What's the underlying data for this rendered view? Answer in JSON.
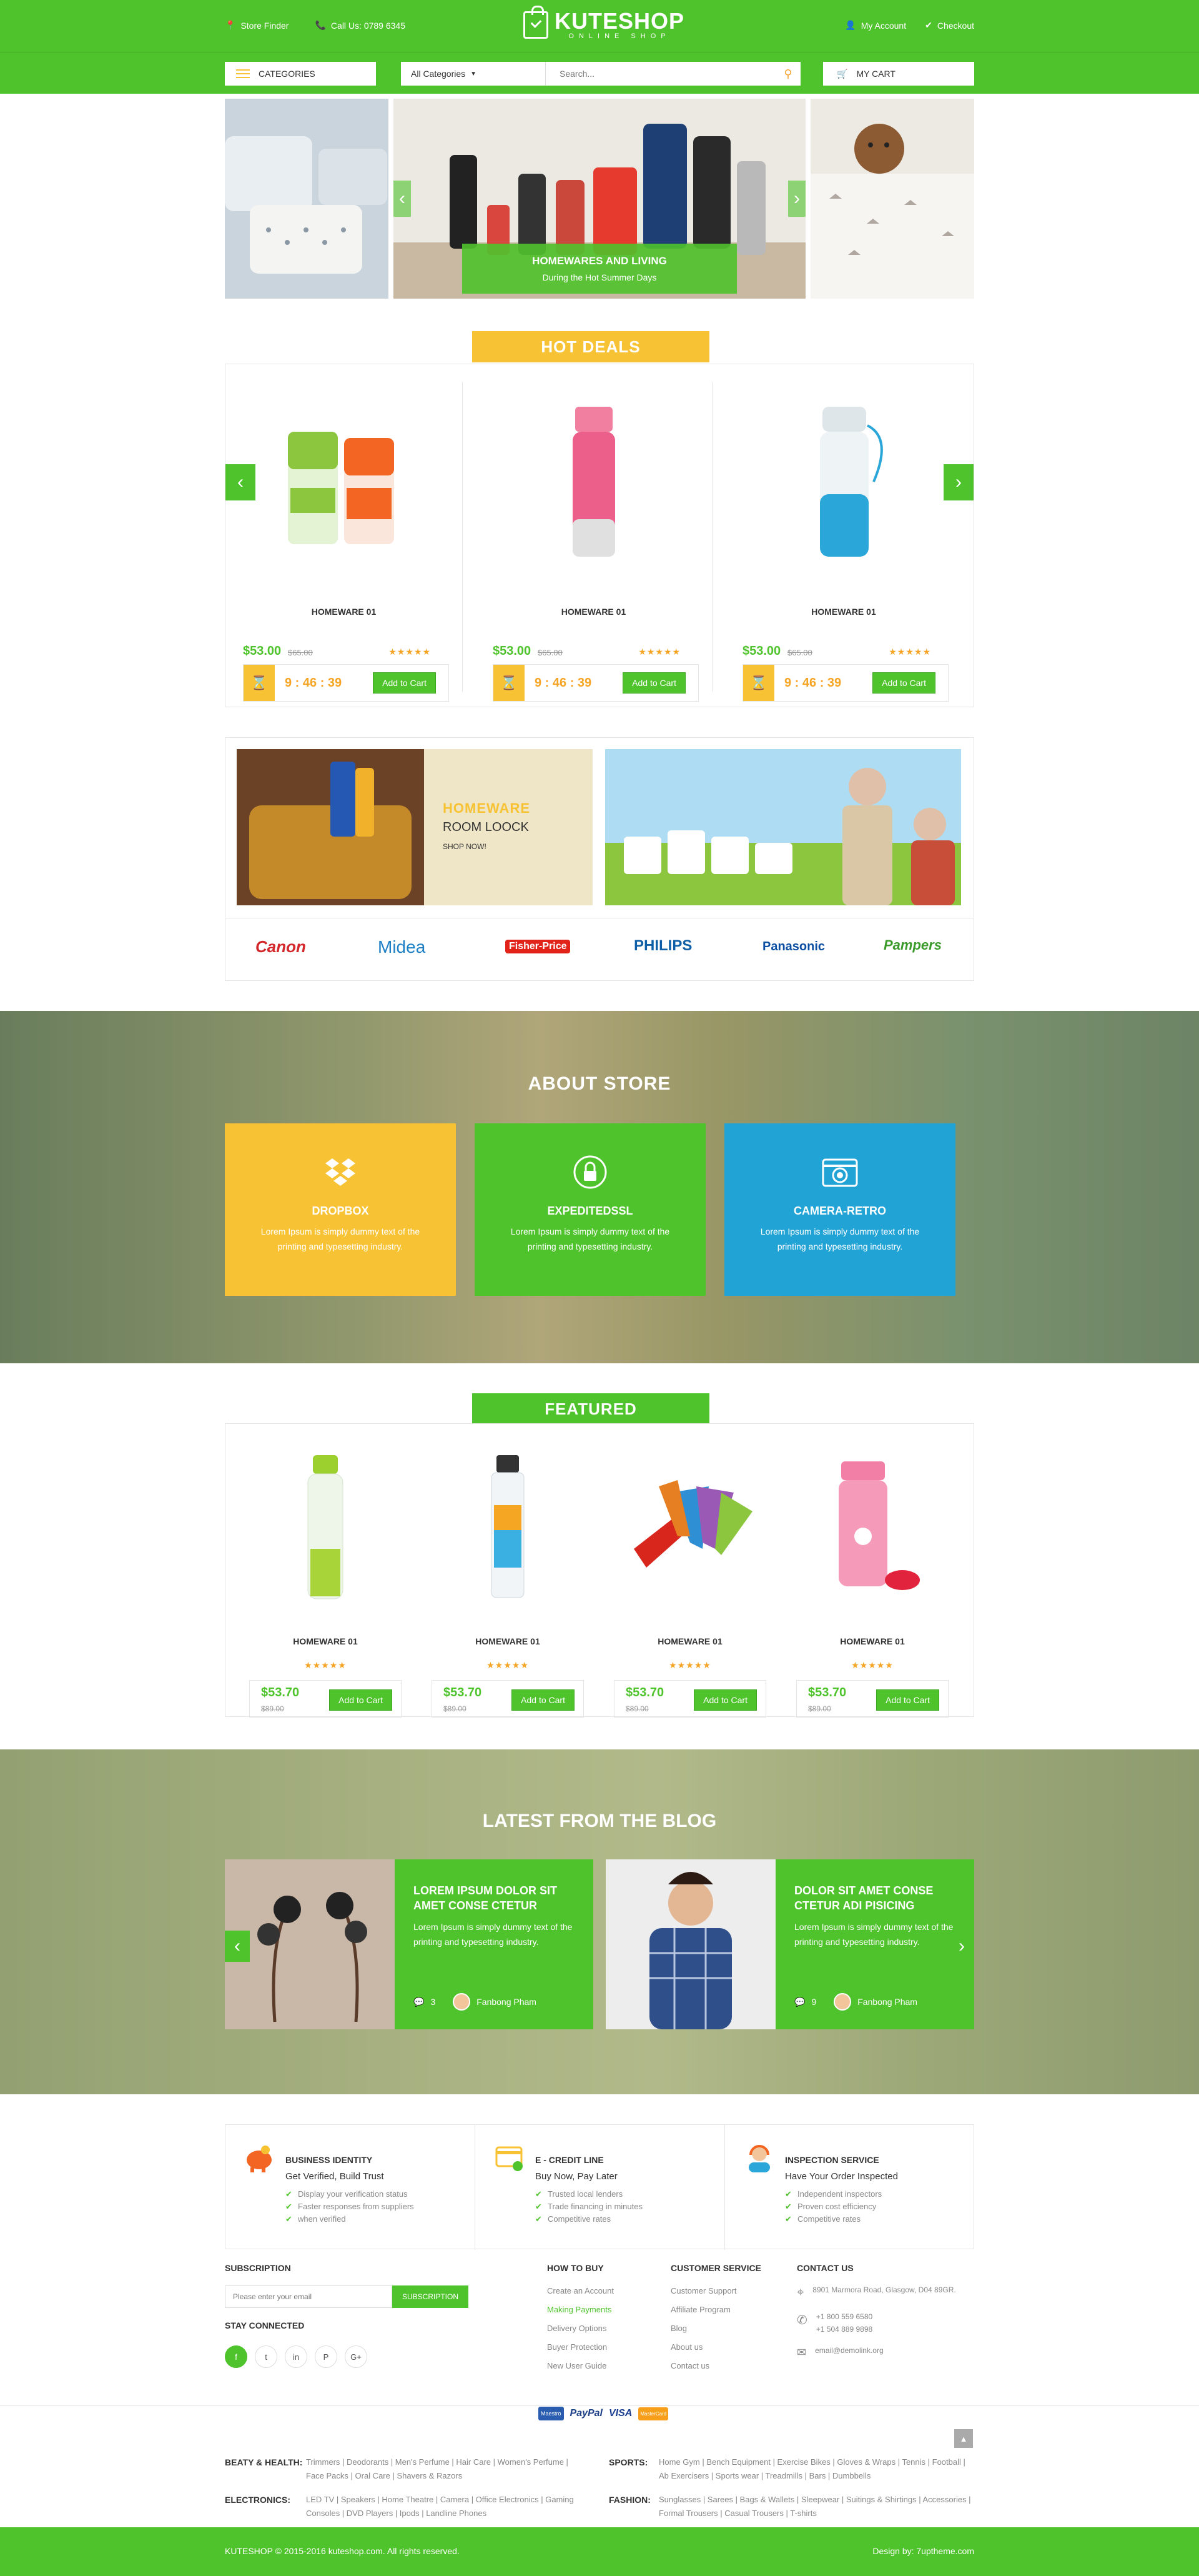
{
  "header": {
    "store_finder": "Store Finder",
    "call_us": "Call Us: 0789 6345",
    "logo_name": "KUTESHOP",
    "logo_sub": "ONLINE SHOP",
    "my_account": "My Account",
    "checkout": "Checkout"
  },
  "nav": {
    "categories_label": "CATEGORIES",
    "search_category": "All Categories",
    "search_placeholder": "Search...",
    "cart_label": "MY CART"
  },
  "hero": {
    "caption_title": "HOMEWARES AND LIVING",
    "caption_sub": "During the Hot Summer Days"
  },
  "hot_deals": {
    "title": "HOT DEALS",
    "items": [
      {
        "name": "HOMEWARE 01",
        "price": "$53.00",
        "old_price": "$65.00",
        "timer": "9 : 46 : 39",
        "cta": "Add to Cart",
        "rating": 4.5
      },
      {
        "name": "HOMEWARE 01",
        "price": "$53.00",
        "old_price": "$65.00",
        "timer": "9 : 46 : 39",
        "cta": "Add to Cart",
        "rating": 4.5
      },
      {
        "name": "HOMEWARE 01",
        "price": "$53.00",
        "old_price": "$65.00",
        "timer": "9 : 46 : 39",
        "cta": "Add to Cart",
        "rating": 4.5
      }
    ]
  },
  "promo": {
    "banner1_line1": "HOMEWARE",
    "banner1_line2": "ROOM LOOCK",
    "banner1_cta": "SHOP NOW!",
    "brands": [
      "Canon",
      "Midea",
      "Fisher-Price",
      "PHILIPS",
      "Panasonic",
      "Pampers"
    ]
  },
  "about": {
    "title": "ABOUT STORE",
    "features": [
      {
        "title": "DROPBOX",
        "desc": "Lorem Ipsum is simply dummy text of the printing and typesetting industry.",
        "color": "#f7c335",
        "icon": "dropbox-icon"
      },
      {
        "title": "EXPEDITEDSSL",
        "desc": "Lorem Ipsum is simply dummy text of the printing and typesetting industry.",
        "color": "#4fc32c",
        "icon": "lock-icon"
      },
      {
        "title": "CAMERA-RETRO",
        "desc": "Lorem Ipsum is simply dummy text of the printing and typesetting industry.",
        "color": "#22a3d6",
        "icon": "camera-icon"
      }
    ]
  },
  "featured": {
    "title": "FEATURED",
    "items": [
      {
        "name": "HOMEWARE 01",
        "price": "$53.70",
        "old_price": "$89.00",
        "cta": "Add to Cart"
      },
      {
        "name": "HOMEWARE 01",
        "price": "$53.70",
        "old_price": "$89.00",
        "cta": "Add to Cart"
      },
      {
        "name": "HOMEWARE 01",
        "price": "$53.70",
        "old_price": "$89.00",
        "cta": "Add to Cart"
      },
      {
        "name": "HOMEWARE 01",
        "price": "$53.70",
        "old_price": "$89.00",
        "cta": "Add to Cart"
      }
    ]
  },
  "blog": {
    "title": "LATEST FROM THE BLOG",
    "posts": [
      {
        "title": "LOREM IPSUM DOLOR SIT AMET CONSE CTETUR",
        "desc": "Lorem Ipsum is simply dummy text of the printing and typesetting industry.",
        "comments": "3",
        "author": "Fanbong Pham"
      },
      {
        "title": "DOLOR SIT AMET CONSE CTETUR ADI PISICING",
        "desc": "Lorem Ipsum is simply dummy text of the printing and typesetting industry.",
        "comments": "9",
        "author": "Fanbong Pham"
      }
    ]
  },
  "services": [
    {
      "title": "BUSINESS IDENTITY",
      "subtitle": "Get Verified, Build Trust",
      "points": [
        "Display your verification status",
        "Faster responses from suppliers",
        "when verified"
      ]
    },
    {
      "title": "E - CREDIT LINE",
      "subtitle": "Buy Now, Pay Later",
      "points": [
        "Trusted local lenders",
        "Trade financing in minutes",
        "Competitive rates"
      ]
    },
    {
      "title": "INSPECTION SERVICE",
      "subtitle": "Have Your Order Inspected",
      "points": [
        "Independent inspectors",
        "Proven cost efficiency",
        "Competitive rates"
      ]
    }
  ],
  "footer": {
    "subscription_title": "SUBSCRIPTION",
    "email_placeholder": "Please enter your email",
    "subscribe_btn": "SUBSCRIPTION",
    "stay_connected": "STAY CONNECTED",
    "howto_title": "HOW TO BUY",
    "howto_links": [
      "Create an Account",
      "Making Payments",
      "Delivery Options",
      "Buyer Protection",
      "New User Guide"
    ],
    "customer_title": "CUSTOMER SERVICE",
    "customer_links": [
      "Customer Support",
      "Affiliate Program",
      "Blog",
      "About us",
      "Contact us"
    ],
    "contact_title": "CONTACT US",
    "address": "8901 Marmora Road, Glasgow, D04 89GR.",
    "phones": [
      "+1 800 559 6580",
      "+1 504 889 9898"
    ],
    "email": "email@demolink.org",
    "payments": [
      "Maestro",
      "PayPal",
      "VISA",
      "MasterCard"
    ],
    "cats": {
      "beauty_label": "BEATY & HEALTH:",
      "beauty_links": "Trimmers | Deodorants | Men's Perfume | Hair Care | Women's Perfume | Face Packs | Oral Care | Shavers & Razors",
      "sports_label": "SPORTS:",
      "sports_links": "Home Gym | Bench Equipment | Exercise Bikes | Gloves & Wraps | Tennis | Football | Ab Exercisers | Sports wear | Treadmills | Bars | Dumbbells",
      "electronics_label": "ELECTRONICS:",
      "electronics_links": "LED TV | Speakers | Home Theatre | Camera | Office Electronics | Gaming Consoles | DVD Players | Ipods | Landline Phones",
      "fashion_label": "FASHION:",
      "fashion_links": "Sunglasses | Sarees | Bags & Wallets | Sleepwear | Suitings & Shirtings | Accessories | Formal Trousers | Casual Trousers | T-shirts"
    },
    "copyright": "KUTESHOP © 2015-2016 kuteshop.com. All rights reserved.",
    "design_by": "Design by: 7uptheme.com"
  }
}
